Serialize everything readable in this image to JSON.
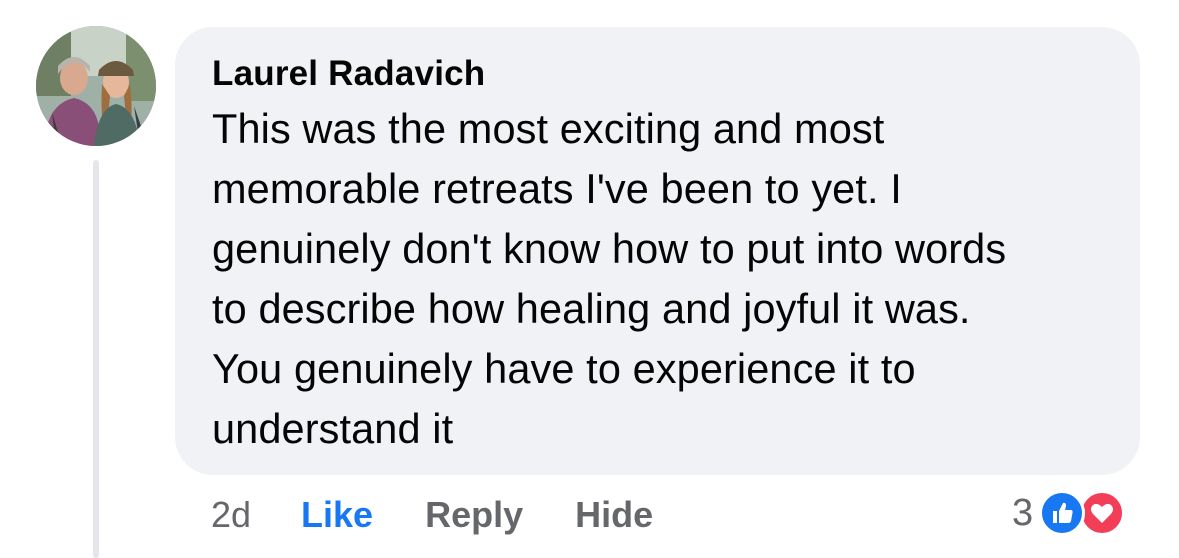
{
  "comment": {
    "author": "Laurel Radavich",
    "text_lines": [
      "This was the most exciting and most",
      "memorable retreats I've been to yet. I",
      "genuinely don't know how to put into words",
      "to describe how healing and joyful it was.",
      "You genuinely have to experience it to",
      "understand it"
    ],
    "time": "2d",
    "like_label": "Like",
    "reply_label": "Reply",
    "hide_label": "Hide",
    "reaction_count": "3",
    "reactions": [
      "like-icon",
      "love-icon"
    ]
  },
  "colors": {
    "bubble": "#f0f2f5",
    "text": "#050505",
    "meta": "#65676b",
    "like_blue": "#1877f2",
    "love_red": "#f33e58"
  }
}
